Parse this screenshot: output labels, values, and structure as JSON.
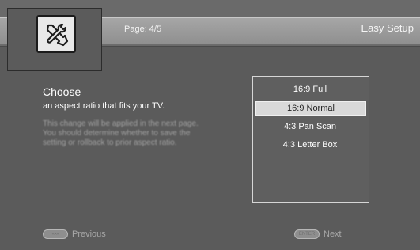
{
  "header": {
    "page_indicator": "Page: 4/5",
    "title": "Easy Setup",
    "settings_icon": "wrench-icon"
  },
  "content": {
    "heading": "Choose",
    "subheading": "an aspect ratio that fits your TV.",
    "description_lines": [
      "This change will be applied in the next page.",
      "You should determine whether to save the",
      "setting or rollback to prior aspect ratio."
    ]
  },
  "options": {
    "items": [
      {
        "label": "16:9 Full",
        "selected": false
      },
      {
        "label": "16:9 Normal",
        "selected": true
      },
      {
        "label": "4:3 Pan Scan",
        "selected": false
      },
      {
        "label": "4:3 Letter Box",
        "selected": false
      }
    ]
  },
  "footer": {
    "previous_label": "Previous",
    "previous_key": "«▪»",
    "next_label": "Next",
    "next_key": "ENTER"
  },
  "colors": {
    "background": "#5b5b5b",
    "header_bar": "#9a9a9a",
    "selected_highlight": "#d9d9d9"
  }
}
